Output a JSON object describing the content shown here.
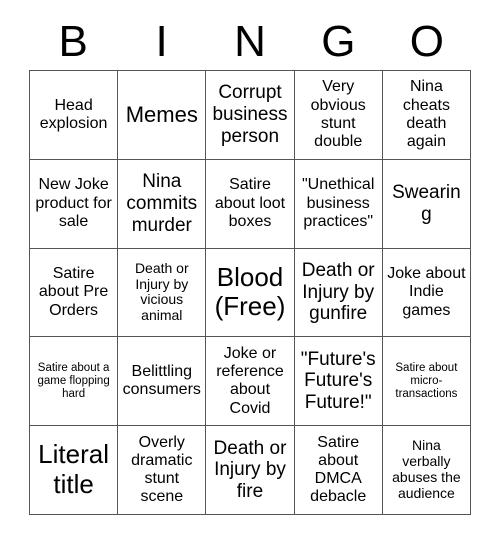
{
  "card": {
    "title_letters": [
      "B",
      "I",
      "N",
      "G",
      "O"
    ],
    "columns": 5,
    "rows": 5,
    "free_space_label": "Blood (Free)",
    "border_color": "#555555",
    "background_color": "#ffffff",
    "text_color": "#000000"
  },
  "grid": {
    "cells": [
      {
        "text": "Head explosion",
        "size": "md",
        "free": false
      },
      {
        "text": "Memes",
        "size": "xl",
        "free": false
      },
      {
        "text": "Corrupt business person",
        "size": "lg",
        "free": false
      },
      {
        "text": "Very obvious stunt double",
        "size": "md",
        "free": false
      },
      {
        "text": "Nina cheats death again",
        "size": "md",
        "free": false
      },
      {
        "text": "New Joke product for sale",
        "size": "md",
        "free": false
      },
      {
        "text": "Nina commits murder",
        "size": "lg",
        "free": false
      },
      {
        "text": "Satire about loot boxes",
        "size": "md",
        "free": false
      },
      {
        "text": "\"Unethical business practices\"",
        "size": "md",
        "free": false
      },
      {
        "text": "Swearing",
        "size": "lg",
        "free": false
      },
      {
        "text": "Satire about Pre Orders",
        "size": "md",
        "free": false
      },
      {
        "text": "Death or Injury by vicious animal",
        "size": "sm",
        "free": false
      },
      {
        "text": "Blood (Free)",
        "size": "xxl",
        "free": true
      },
      {
        "text": "Death or Injury by gunfire",
        "size": "lg",
        "free": false
      },
      {
        "text": "Joke about Indie games",
        "size": "md",
        "free": false
      },
      {
        "text": "Satire about a game flopping hard",
        "size": "xs",
        "free": false
      },
      {
        "text": "Belittling consumers",
        "size": "md",
        "free": false
      },
      {
        "text": "Joke or reference about Covid",
        "size": "md",
        "free": false
      },
      {
        "text": "\"Future's Future's Future!\"",
        "size": "lg",
        "free": false
      },
      {
        "text": "Satire about micro-transactions",
        "size": "xs",
        "free": false
      },
      {
        "text": "Literal title",
        "size": "xxl",
        "free": true
      },
      {
        "text": "Overly dramatic stunt scene",
        "size": "md",
        "free": false
      },
      {
        "text": "Death or Injury by fire",
        "size": "lg",
        "free": false
      },
      {
        "text": "Satire about DMCA debacle",
        "size": "md",
        "free": false
      },
      {
        "text": "Nina verbally abuses the audience",
        "size": "sm",
        "free": false
      }
    ]
  }
}
